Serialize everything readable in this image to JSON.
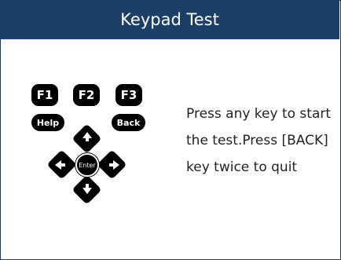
{
  "header": {
    "title": "Keypad Test"
  },
  "keypad": {
    "f1": "F1",
    "f2": "F2",
    "f3": "F3",
    "help": "Help",
    "back": "Back",
    "enter": "Enter"
  },
  "instructions": {
    "lines": [
      "Press any key to start",
      "the test.Press [BACK]",
      "key twice to quit"
    ]
  },
  "colors": {
    "header_bg": "#1c3f66",
    "header_text": "#ffffff",
    "key_bg": "#000000",
    "key_text": "#ffffff",
    "body_text": "#222222"
  },
  "icons": {
    "up": "arrow-up-icon",
    "down": "arrow-down-icon",
    "left": "arrow-left-icon",
    "right": "arrow-right-icon"
  }
}
